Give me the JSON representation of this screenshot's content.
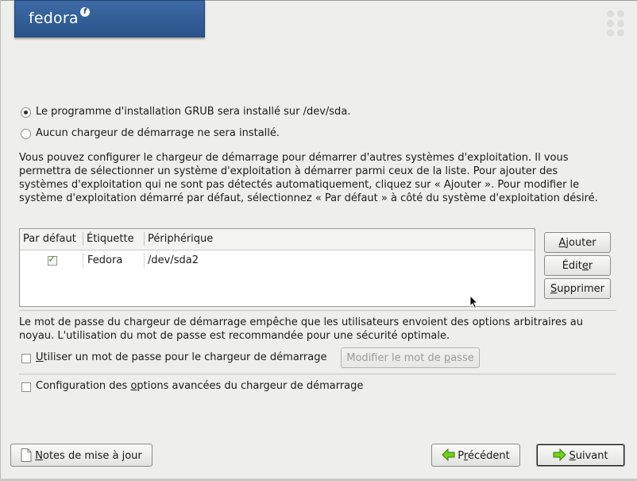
{
  "header": {
    "logo_text": "fedora",
    "logo_badge": "f"
  },
  "bootloader_options": {
    "grub_install": {
      "label": "Le programme d'installation GRUB sera installé sur /dev/sda.",
      "selected": true
    },
    "no_bootloader": {
      "label": "Aucun chargeur de démarrage ne sera installé.",
      "selected": false
    }
  },
  "description": "Vous pouvez configurer le chargeur de démarrage pour démarrer d'autres systèmes d'exploitation. Il vous permettra de sélectionner un système d'exploitation à démarrer parmi ceux de la liste. Pour ajouter des systèmes d'exploitation qui ne sont pas détectés automatiquement, cliquez sur « Ajouter ». Pour modifier le système d'exploitation démarré par défaut, sélectionnez « Par défaut » à côté du système d'exploitation désiré.",
  "os_table": {
    "columns": [
      "Par défaut",
      "Étiquette",
      "Périphérique"
    ],
    "rows": [
      {
        "default": true,
        "label": "Fedora",
        "device": "/dev/sda2"
      }
    ]
  },
  "table_buttons": {
    "add": {
      "pre": "",
      "accel": "A",
      "post": "jouter"
    },
    "edit": {
      "pre": "Édit",
      "accel": "e",
      "post": "r"
    },
    "delete": {
      "pre": "",
      "accel": "S",
      "post": "upprimer"
    }
  },
  "password_section": {
    "description": "Le mot de passe du chargeur de démarrage empêche que les utilisateurs envoient des options arbitraires au noyau. L'utilisation du mot de passe est recommandée pour une sécurité optimale.",
    "use_password": {
      "accel": "U",
      "rest": "tiliser un mot de passe pour le chargeur de démarrage",
      "checked": false
    },
    "change_password_button": {
      "pre": "Modifier le mot de ",
      "accel": "p",
      "post": "asse",
      "enabled": false
    }
  },
  "advanced_options": {
    "pre": "Configuration des ",
    "accel": "o",
    "post": "ptions avancées du chargeur de démarrage",
    "checked": false
  },
  "footer": {
    "release_notes": {
      "pre": "",
      "accel": "N",
      "post": "otes de mise à jour"
    },
    "back": {
      "pre": "P",
      "accel": "r",
      "post": "écédent"
    },
    "next": {
      "pre": "",
      "accel": "S",
      "post": "uivant"
    }
  }
}
